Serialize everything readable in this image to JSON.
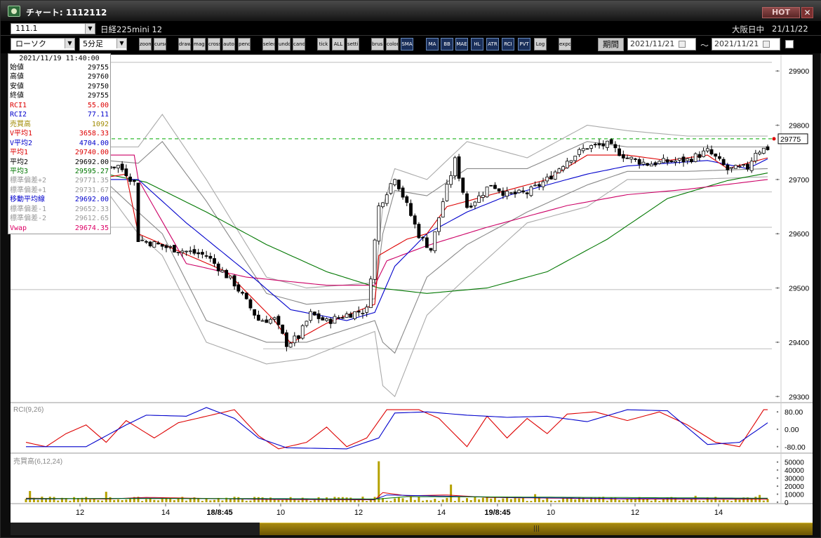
{
  "window": {
    "title": "チャート: 1112112",
    "hot_label": "HOT",
    "close_glyph": "✕"
  },
  "topbar": {
    "symbol_code": "111.1",
    "instrument": "日経225mini 12",
    "market_status": "大阪日中",
    "market_date": "21/11/22"
  },
  "toolbar": {
    "chart_type": "ローソク",
    "period": "5分足",
    "period_button": "期間",
    "date_from": "2021/11/21",
    "date_to": "2021/11/21",
    "date_separator": "～",
    "buttons": [
      "zoom",
      "cursor",
      "drawdown",
      "magnify",
      "crosshair",
      "auto",
      "pencil",
      "select",
      "undo",
      "candle",
      "tick",
      "ALL",
      "settings",
      "brush",
      "color",
      "SMA",
      "MA",
      "BB",
      "MAE",
      "HL",
      "ATR",
      "RCI",
      "PVT",
      "Log",
      "export"
    ]
  },
  "info_panel": {
    "datetime": "2021/11/19 11:40:00",
    "rows": [
      {
        "label": "始値",
        "value": "29755",
        "color": "#000000"
      },
      {
        "label": "高値",
        "value": "29760",
        "color": "#000000"
      },
      {
        "label": "安値",
        "value": "29750",
        "color": "#000000"
      },
      {
        "label": "終値",
        "value": "29755",
        "color": "#000000"
      },
      {
        "label": "RCI1",
        "value": "55.00",
        "color": "#dd0000"
      },
      {
        "label": "RCI2",
        "value": "77.11",
        "color": "#0000cc"
      },
      {
        "label": "売買高",
        "value": "1092",
        "color": "#a08a00"
      },
      {
        "label": "V平均1",
        "value": "3658.33",
        "color": "#dd0000"
      },
      {
        "label": "V平均2",
        "value": "4704.00",
        "color": "#0000cc"
      },
      {
        "label": "平均1",
        "value": "29740.00",
        "color": "#dd0000"
      },
      {
        "label": "平均2",
        "value": "29692.00",
        "color": "#000000"
      },
      {
        "label": "平均3",
        "value": "29595.27",
        "color": "#007700"
      },
      {
        "label": "標準偏差+2",
        "value": "29771.35",
        "color": "#9a9a9a"
      },
      {
        "label": "標準偏差+1",
        "value": "29731.67",
        "color": "#9a9a9a"
      },
      {
        "label": "移動平均線",
        "value": "29692.00",
        "color": "#0000cc"
      },
      {
        "label": "標準偏差-1",
        "value": "29652.33",
        "color": "#9a9a9a"
      },
      {
        "label": "標準偏差-2",
        "value": "29612.65",
        "color": "#9a9a9a"
      },
      {
        "label": "Vwap",
        "value": "29674.35",
        "color": "#dd0066"
      }
    ]
  },
  "chart_data": [
    {
      "type": "candlestick",
      "ylim": [
        29290,
        29930
      ],
      "y_ticks": [
        "29300",
        "29400",
        "29500",
        "29600",
        "29700",
        "29800",
        "29900"
      ],
      "x_ticks": [
        "12",
        "14",
        "18/8:45",
        "10",
        "12",
        "14",
        "19/8:45",
        "10",
        "12",
        "14"
      ],
      "x_tick_bold": [
        false,
        false,
        true,
        false,
        false,
        false,
        true,
        false,
        false,
        false
      ],
      "last_price_label": "29775",
      "last_price": 29775,
      "ref_lines": [
        29916,
        29677,
        29612,
        29497,
        29388
      ],
      "colors": {
        "up": "#ffffff",
        "down": "#000000",
        "ma_fast": "#dd0000",
        "ma_mid": "#0000cc",
        "ma_slow": "#007700",
        "vwap": "#cc0066",
        "band": "#aaaaaa",
        "dashed": "#00aa00"
      },
      "close_anchors": [
        [
          0,
          29678
        ],
        [
          8,
          29688
        ],
        [
          16,
          29715
        ],
        [
          20,
          29724
        ],
        [
          23,
          29725
        ],
        [
          25,
          29712
        ],
        [
          27,
          29694
        ],
        [
          28,
          29590
        ],
        [
          35,
          29575
        ],
        [
          45,
          29560
        ],
        [
          52,
          29508
        ],
        [
          58,
          29441
        ],
        [
          62,
          29442
        ],
        [
          65,
          29397
        ],
        [
          68,
          29410
        ],
        [
          71,
          29452
        ],
        [
          75,
          29438
        ],
        [
          80,
          29451
        ],
        [
          85,
          29460
        ],
        [
          88,
          29650
        ],
        [
          92,
          29706
        ],
        [
          95,
          29652
        ],
        [
          98,
          29598
        ],
        [
          101,
          29571
        ],
        [
          104,
          29660
        ],
        [
          107,
          29735
        ],
        [
          110,
          29650
        ],
        [
          113,
          29668
        ],
        [
          116,
          29692
        ],
        [
          120,
          29672
        ],
        [
          125,
          29675
        ],
        [
          130,
          29700
        ],
        [
          135,
          29736
        ],
        [
          140,
          29760
        ],
        [
          145,
          29764
        ],
        [
          150,
          29740
        ],
        [
          155,
          29729
        ],
        [
          160,
          29733
        ],
        [
          165,
          29736
        ],
        [
          170,
          29752
        ],
        [
          172,
          29740
        ],
        [
          175,
          29718
        ],
        [
          180,
          29722
        ],
        [
          182,
          29752
        ],
        [
          185,
          29758
        ]
      ],
      "ma_fast_anchors": [
        [
          0,
          29680
        ],
        [
          25,
          29710
        ],
        [
          28,
          29600
        ],
        [
          50,
          29530
        ],
        [
          62,
          29440
        ],
        [
          66,
          29398
        ],
        [
          75,
          29435
        ],
        [
          87,
          29470
        ],
        [
          88,
          29560
        ],
        [
          95,
          29590
        ],
        [
          100,
          29600
        ],
        [
          105,
          29650
        ],
        [
          110,
          29660
        ],
        [
          120,
          29680
        ],
        [
          130,
          29700
        ],
        [
          140,
          29745
        ],
        [
          150,
          29745
        ],
        [
          160,
          29735
        ],
        [
          170,
          29745
        ],
        [
          175,
          29720
        ],
        [
          185,
          29740
        ]
      ],
      "ma_mid_anchors": [
        [
          0,
          29680
        ],
        [
          20,
          29700
        ],
        [
          28,
          29700
        ],
        [
          40,
          29620
        ],
        [
          55,
          29530
        ],
        [
          66,
          29460
        ],
        [
          80,
          29440
        ],
        [
          87,
          29455
        ],
        [
          92,
          29540
        ],
        [
          100,
          29600
        ],
        [
          110,
          29640
        ],
        [
          120,
          29670
        ],
        [
          130,
          29690
        ],
        [
          140,
          29710
        ],
        [
          150,
          29725
        ],
        [
          160,
          29730
        ],
        [
          170,
          29735
        ],
        [
          180,
          29720
        ],
        [
          185,
          29738
        ]
      ],
      "ma_slow_anchors": [
        [
          0,
          29735
        ],
        [
          20,
          29710
        ],
        [
          30,
          29695
        ],
        [
          45,
          29640
        ],
        [
          60,
          29580
        ],
        [
          75,
          29530
        ],
        [
          88,
          29500
        ],
        [
          100,
          29490
        ],
        [
          115,
          29500
        ],
        [
          130,
          29530
        ],
        [
          145,
          29590
        ],
        [
          160,
          29665
        ],
        [
          175,
          29698
        ],
        [
          185,
          29712
        ]
      ],
      "vwap_anchors": [
        [
          0,
          29745
        ],
        [
          27,
          29745
        ],
        [
          28,
          29700
        ],
        [
          40,
          29545
        ],
        [
          55,
          29520
        ],
        [
          75,
          29505
        ],
        [
          87,
          29505
        ],
        [
          90,
          29550
        ],
        [
          100,
          29578
        ],
        [
          115,
          29612
        ],
        [
          135,
          29652
        ],
        [
          150,
          29672
        ],
        [
          165,
          29682
        ],
        [
          185,
          29700
        ]
      ],
      "band_outer_anchors": [
        [
          0,
          29700,
          29640
        ],
        [
          20,
          29760,
          29680
        ],
        [
          28,
          29760,
          29600
        ],
        [
          34,
          29820,
          29560
        ],
        [
          45,
          29700,
          29400
        ],
        [
          60,
          29520,
          29360
        ],
        [
          70,
          29500,
          29370
        ],
        [
          87,
          29510,
          29420
        ],
        [
          89,
          29650,
          29320
        ],
        [
          92,
          29720,
          29300
        ],
        [
          100,
          29700,
          29450
        ],
        [
          110,
          29770,
          29520
        ],
        [
          125,
          29740,
          29620
        ],
        [
          140,
          29800,
          29650
        ],
        [
          150,
          29790,
          29700
        ],
        [
          165,
          29780,
          29700
        ],
        [
          185,
          29780,
          29705
        ]
      ],
      "band_inner_anchors": [
        [
          0,
          29690,
          29660
        ],
        [
          20,
          29735,
          29695
        ],
        [
          28,
          29730,
          29640
        ],
        [
          34,
          29770,
          29600
        ],
        [
          45,
          29660,
          29440
        ],
        [
          60,
          29490,
          29400
        ],
        [
          70,
          29470,
          29400
        ],
        [
          87,
          29480,
          29440
        ],
        [
          89,
          29600,
          29400
        ],
        [
          92,
          29680,
          29380
        ],
        [
          100,
          29670,
          29520
        ],
        [
          110,
          29720,
          29580
        ],
        [
          125,
          29720,
          29640
        ],
        [
          140,
          29770,
          29690
        ],
        [
          150,
          29760,
          29715
        ],
        [
          165,
          29760,
          29715
        ],
        [
          185,
          29760,
          29720
        ]
      ],
      "n_bars": 186,
      "seed": 7
    },
    {
      "type": "line",
      "title": "RCI(9,26)",
      "ylim": [
        -100,
        100
      ],
      "y_ticks": [
        "80.00",
        "0.00",
        "-80.00"
      ],
      "series": [
        {
          "name": "RCI1",
          "color": "#dd0000",
          "anchors": [
            [
              0,
              -60
            ],
            [
              5,
              -80
            ],
            [
              10,
              -20
            ],
            [
              15,
              20
            ],
            [
              20,
              -60
            ],
            [
              25,
              40
            ],
            [
              32,
              -40
            ],
            [
              38,
              30
            ],
            [
              45,
              60
            ],
            [
              52,
              90
            ],
            [
              58,
              -30
            ],
            [
              63,
              -90
            ],
            [
              70,
              -60
            ],
            [
              75,
              10
            ],
            [
              80,
              -80
            ],
            [
              85,
              -40
            ],
            [
              90,
              90
            ],
            [
              98,
              90
            ],
            [
              103,
              50
            ],
            [
              110,
              -80
            ],
            [
              115,
              60
            ],
            [
              120,
              -40
            ],
            [
              125,
              50
            ],
            [
              130,
              -20
            ],
            [
              135,
              70
            ],
            [
              142,
              80
            ],
            [
              150,
              40
            ],
            [
              158,
              80
            ],
            [
              165,
              20
            ],
            [
              172,
              -60
            ],
            [
              178,
              -80
            ],
            [
              184,
              90
            ]
          ]
        },
        {
          "name": "RCI2",
          "color": "#0000cc",
          "anchors": [
            [
              0,
              -80
            ],
            [
              15,
              -80
            ],
            [
              25,
              20
            ],
            [
              30,
              65
            ],
            [
              40,
              60
            ],
            [
              45,
              100
            ],
            [
              52,
              50
            ],
            [
              58,
              -40
            ],
            [
              65,
              -85
            ],
            [
              80,
              -90
            ],
            [
              88,
              -40
            ],
            [
              92,
              75
            ],
            [
              100,
              80
            ],
            [
              110,
              65
            ],
            [
              120,
              55
            ],
            [
              130,
              60
            ],
            [
              140,
              35
            ],
            [
              150,
              90
            ],
            [
              160,
              85
            ],
            [
              170,
              -70
            ],
            [
              178,
              -60
            ],
            [
              185,
              30
            ]
          ]
        }
      ]
    },
    {
      "type": "bar",
      "title": "売買高(6,12,24)",
      "ylim": [
        0,
        55000
      ],
      "y_ticks": [
        "50000",
        "40000",
        "30000",
        "20000",
        "10000",
        "0"
      ],
      "bar_color": "#b5a100",
      "spike_bars": [
        [
          88,
          51000
        ],
        [
          106,
          22000
        ],
        [
          1,
          14000
        ],
        [
          20,
          13000
        ],
        [
          127,
          10000
        ],
        [
          167,
          8000
        ],
        [
          183,
          9000
        ]
      ],
      "ma_lines": [
        {
          "color": "#dd0000",
          "anchors": [
            [
              0,
              5000
            ],
            [
              20,
              4000
            ],
            [
              30,
              6000
            ],
            [
              60,
              3500
            ],
            [
              87,
              3000
            ],
            [
              89,
              12000
            ],
            [
              95,
              8000
            ],
            [
              105,
              9000
            ],
            [
              115,
              6000
            ],
            [
              150,
              4000
            ],
            [
              185,
              3658
            ]
          ]
        },
        {
          "color": "#0000cc",
          "anchors": [
            [
              0,
              4000
            ],
            [
              30,
              5000
            ],
            [
              60,
              4000
            ],
            [
              87,
              3500
            ],
            [
              90,
              9000
            ],
            [
              100,
              8000
            ],
            [
              120,
              6000
            ],
            [
              150,
              4500
            ],
            [
              185,
              4704
            ]
          ]
        },
        {
          "color": "#007700",
          "anchors": [
            [
              0,
              4500
            ],
            [
              60,
              4500
            ],
            [
              88,
              4000
            ],
            [
              95,
              7000
            ],
            [
              120,
              6500
            ],
            [
              185,
              5000
            ]
          ]
        }
      ]
    }
  ]
}
